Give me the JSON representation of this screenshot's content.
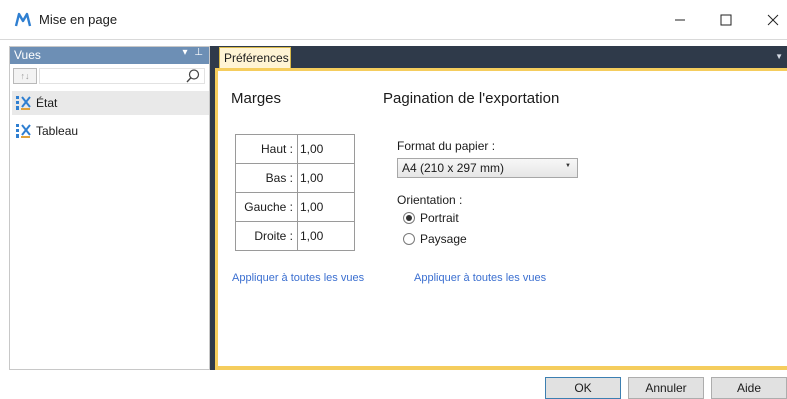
{
  "window": {
    "title": "Mise en page",
    "controls": {
      "minimize": "–",
      "maximize": "☐",
      "close": "✕"
    },
    "logo_icon": "m-logo-icon",
    "accent": "#2f7fd1"
  },
  "sidebar": {
    "title": "Vues",
    "header_controls": "▾ ⊥",
    "sort_label": "↑↓",
    "search_icon": "search-icon",
    "items": [
      {
        "label": "État",
        "icon": "report-icon",
        "selected": true
      },
      {
        "label": "Tableau",
        "icon": "table-icon",
        "selected": false
      }
    ]
  },
  "tabs": {
    "active": "Préférences",
    "dropdown": "▼"
  },
  "margins": {
    "title": "Marges",
    "rows": [
      {
        "label": "Haut :",
        "value": "1,00"
      },
      {
        "label": "Bas :",
        "value": "1,00"
      },
      {
        "label": "Gauche :",
        "value": "1,00"
      },
      {
        "label": "Droite :",
        "value": "1,00"
      }
    ],
    "apply_link": "Appliquer à toutes les vues"
  },
  "pagination": {
    "title": "Pagination de l'exportation",
    "paper_format_label": "Format du papier :",
    "paper_format_value": "A4 (210 x 297 mm)",
    "orientation_label": "Orientation :",
    "orientation_options": [
      {
        "label": "Portrait",
        "checked": true
      },
      {
        "label": "Paysage",
        "checked": false
      }
    ],
    "apply_link": "Appliquer à toutes les vues"
  },
  "footer": {
    "ok": "OK",
    "cancel": "Annuler",
    "help": "Aide"
  }
}
